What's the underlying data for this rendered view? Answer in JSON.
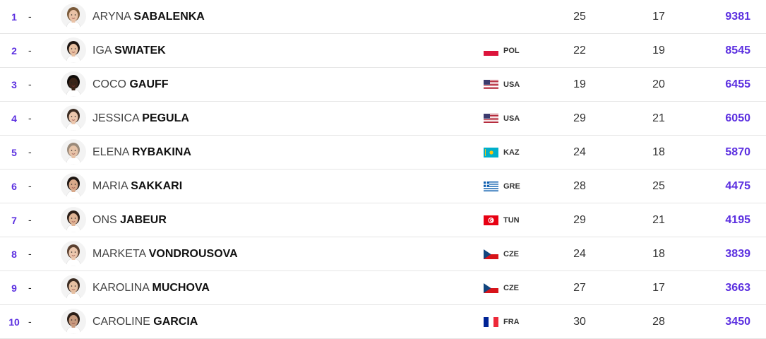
{
  "accent_color": "#5b2fe0",
  "rows": [
    {
      "rank": "1",
      "movement": "-",
      "first": "ARYNA",
      "last": "SABALENKA",
      "country": "",
      "flag": "none",
      "col1": "25",
      "col2": "17",
      "points": "9381"
    },
    {
      "rank": "2",
      "movement": "-",
      "first": "IGA",
      "last": "SWIATEK",
      "country": "POL",
      "flag": "pol",
      "col1": "22",
      "col2": "19",
      "points": "8545"
    },
    {
      "rank": "3",
      "movement": "-",
      "first": "COCO",
      "last": "GAUFF",
      "country": "USA",
      "flag": "usa",
      "col1": "19",
      "col2": "20",
      "points": "6455"
    },
    {
      "rank": "4",
      "movement": "-",
      "first": "JESSICA",
      "last": "PEGULA",
      "country": "USA",
      "flag": "usa",
      "col1": "29",
      "col2": "21",
      "points": "6050"
    },
    {
      "rank": "5",
      "movement": "-",
      "first": "ELENA",
      "last": "RYBAKINA",
      "country": "KAZ",
      "flag": "kaz",
      "col1": "24",
      "col2": "18",
      "points": "5870"
    },
    {
      "rank": "6",
      "movement": "-",
      "first": "MARIA",
      "last": "SAKKARI",
      "country": "GRE",
      "flag": "gre",
      "col1": "28",
      "col2": "25",
      "points": "4475"
    },
    {
      "rank": "7",
      "movement": "-",
      "first": "ONS",
      "last": "JABEUR",
      "country": "TUN",
      "flag": "tun",
      "col1": "29",
      "col2": "21",
      "points": "4195"
    },
    {
      "rank": "8",
      "movement": "-",
      "first": "MARKETA",
      "last": "VONDROUSOVA",
      "country": "CZE",
      "flag": "cze",
      "col1": "24",
      "col2": "18",
      "points": "3839"
    },
    {
      "rank": "9",
      "movement": "-",
      "first": "KAROLINA",
      "last": "MUCHOVA",
      "country": "CZE",
      "flag": "cze",
      "col1": "27",
      "col2": "17",
      "points": "3663"
    },
    {
      "rank": "10",
      "movement": "-",
      "first": "CAROLINE",
      "last": "GARCIA",
      "country": "FRA",
      "flag": "fra",
      "col1": "30",
      "col2": "28",
      "points": "3450"
    }
  ]
}
